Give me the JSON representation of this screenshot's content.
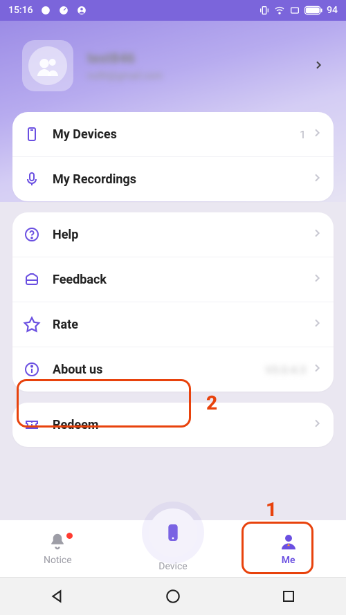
{
  "status": {
    "time": "15:16",
    "battery": "94"
  },
  "profile": {
    "name": "test846",
    "subtitle": "nullit@gmail.com"
  },
  "group1": [
    {
      "icon": "device",
      "label": "My Devices",
      "value": "1"
    },
    {
      "icon": "mic",
      "label": "My Recordings",
      "value": ""
    }
  ],
  "group2": [
    {
      "icon": "help",
      "label": "Help",
      "value": ""
    },
    {
      "icon": "feedback",
      "label": "Feedback",
      "value": ""
    },
    {
      "icon": "star",
      "label": "Rate",
      "value": ""
    },
    {
      "icon": "info",
      "label": "About us",
      "value": "V3.0.4.3"
    }
  ],
  "group3": [
    {
      "icon": "ticket",
      "label": "Redeem",
      "value": ""
    }
  ],
  "nav": {
    "notice": "Notice",
    "device": "Device",
    "me": "Me"
  },
  "annot": {
    "one": "1",
    "two": "2"
  },
  "colors": {
    "accent": "#6a4fe1",
    "highlight": "#e8420c"
  }
}
